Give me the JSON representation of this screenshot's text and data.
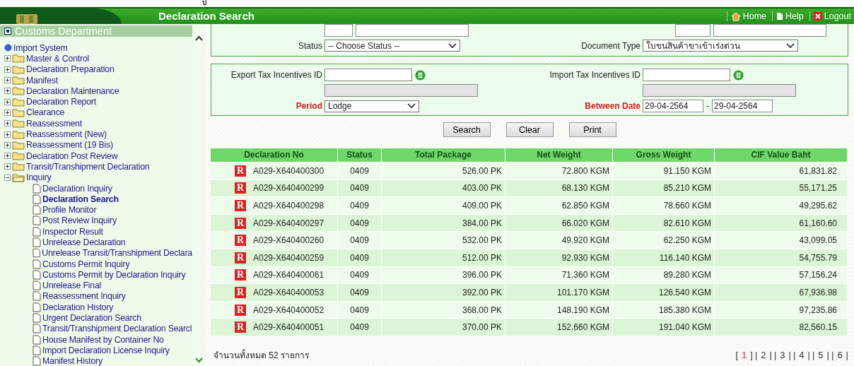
{
  "top_fragment": "ป",
  "header": {
    "title": "Declaration Search",
    "links": [
      {
        "label": "Home",
        "kind": "home"
      },
      {
        "label": "Help",
        "kind": "help"
      },
      {
        "label": "Logout",
        "kind": "logout"
      }
    ]
  },
  "sidebar": {
    "title": "Customs Department",
    "tree": {
      "label": "Import System",
      "children": [
        {
          "label": "Master & Control",
          "kind": "folder",
          "expanded": false
        },
        {
          "label": "Declaration Preparation",
          "kind": "folder",
          "expanded": false
        },
        {
          "label": "Manifest",
          "kind": "folder",
          "expanded": false
        },
        {
          "label": "Declaration Maintenance",
          "kind": "folder",
          "expanded": false
        },
        {
          "label": "Declaration Report",
          "kind": "folder",
          "expanded": false
        },
        {
          "label": "Clearance",
          "kind": "folder",
          "expanded": false
        },
        {
          "label": "Reassessment",
          "kind": "folder",
          "expanded": false
        },
        {
          "label": "Reassessment  (New)",
          "kind": "folder",
          "expanded": false
        },
        {
          "label": "Reassessment  (19 Bis)",
          "kind": "folder",
          "expanded": false
        },
        {
          "label": "Declaration Post Review",
          "kind": "folder",
          "expanded": false
        },
        {
          "label": "Transit/Transhipment Declaration",
          "kind": "folder",
          "expanded": false
        },
        {
          "label": "Inquiry",
          "kind": "folder",
          "expanded": true,
          "children": [
            {
              "label": "Declaration Inquiry",
              "kind": "page",
              "selected": false
            },
            {
              "label": "Declaration Search",
              "kind": "page",
              "selected": true
            },
            {
              "label": "Profile Monitor",
              "kind": "page",
              "selected": false
            },
            {
              "label": "Post Review Inquiry",
              "kind": "page",
              "selected": false
            },
            {
              "label": "Inspector Result",
              "kind": "page",
              "selected": false
            },
            {
              "label": "Unrelease Declaration",
              "kind": "page",
              "selected": false
            },
            {
              "label": "Unrelease Transit/Transhipment Declara",
              "kind": "page",
              "selected": false
            },
            {
              "label": "Customs Permit Inquiry",
              "kind": "page",
              "selected": false
            },
            {
              "label": "Customs Permit by Declaration Inquiry",
              "kind": "page",
              "selected": false
            },
            {
              "label": "Unrelease Final",
              "kind": "page",
              "selected": false
            },
            {
              "label": "Reassessment Inquiry",
              "kind": "page",
              "selected": false
            },
            {
              "label": "Declaration History",
              "kind": "page",
              "selected": false
            },
            {
              "label": "Urgent Declaration Search",
              "kind": "page",
              "selected": false
            },
            {
              "label": "Transit/Transhipment Declaration Searcl",
              "kind": "page",
              "selected": false
            },
            {
              "label": "House Manifest by Container No",
              "kind": "page",
              "selected": false
            },
            {
              "label": "Import Declaration License Inquiry",
              "kind": "page",
              "selected": false
            },
            {
              "label": "Manifest History",
              "kind": "page",
              "selected": false
            }
          ]
        }
      ]
    }
  },
  "form": {
    "status": {
      "label": "Status",
      "value": "-- Choose Status --"
    },
    "document_type": {
      "label": "Document Type",
      "value": "ใบขนสินค้าขาเข้าเร่งด่วน"
    },
    "export_tax": {
      "label": "Export Tax Incentives ID"
    },
    "import_tax": {
      "label": "Import Tax Incentives ID"
    },
    "period": {
      "label": "Period",
      "value": "Lodge"
    },
    "between_date": {
      "label": "Between Date",
      "from": "29-04-2564",
      "separator": "-",
      "to": "29-04-2564"
    },
    "buttons": [
      "Search",
      "Clear",
      "Print"
    ]
  },
  "table": {
    "columns": [
      "Declaration No",
      "Status",
      "Total Package",
      "Net Weight",
      "Gross Weight",
      "CIF Value Baht"
    ],
    "rows": [
      {
        "badge": "R",
        "declaration_no": "A029-X640400300",
        "status": "0409",
        "total_package": "526.00 PK",
        "net_weight": "72.800 KGM",
        "gross_weight": "91.150 KGM",
        "cif_value": "61,831.82"
      },
      {
        "badge": "R",
        "declaration_no": "A029-X640400299",
        "status": "0409",
        "total_package": "403.00 PK",
        "net_weight": "68.130 KGM",
        "gross_weight": "85.210 KGM",
        "cif_value": "55,171.25"
      },
      {
        "badge": "R",
        "declaration_no": "A029-X640400298",
        "status": "0409",
        "total_package": "409.00 PK",
        "net_weight": "62.850 KGM",
        "gross_weight": "78.660 KGM",
        "cif_value": "49,295.62"
      },
      {
        "badge": "R",
        "declaration_no": "A029-X640400297",
        "status": "0409",
        "total_package": "384.00 PK",
        "net_weight": "66.020 KGM",
        "gross_weight": "82.610 KGM",
        "cif_value": "61,160.60"
      },
      {
        "badge": "R",
        "declaration_no": "A029-X640400260",
        "status": "0409",
        "total_package": "532.00 PK",
        "net_weight": "49.920 KGM",
        "gross_weight": "62.250 KGM",
        "cif_value": "43,099.05"
      },
      {
        "badge": "R",
        "declaration_no": "A029-X640400259",
        "status": "0409",
        "total_package": "512.00 PK",
        "net_weight": "92.930 KGM",
        "gross_weight": "116.140 KGM",
        "cif_value": "54,755.79"
      },
      {
        "badge": "R",
        "declaration_no": "A029-X640400061",
        "status": "0409",
        "total_package": "396.00 PK",
        "net_weight": "71.360 KGM",
        "gross_weight": "89.280 KGM",
        "cif_value": "57,156.24"
      },
      {
        "badge": "R",
        "declaration_no": "A029-X640400053",
        "status": "0409",
        "total_package": "392.00 PK",
        "net_weight": "101.170 KGM",
        "gross_weight": "126.540 KGM",
        "cif_value": "67,936.98"
      },
      {
        "badge": "R",
        "declaration_no": "A029-X640400052",
        "status": "0409",
        "total_package": "368.00 PK",
        "net_weight": "148.190 KGM",
        "gross_weight": "185.380 KGM",
        "cif_value": "97,235.86"
      },
      {
        "badge": "R",
        "declaration_no": "A029-X640400051",
        "status": "0409",
        "total_package": "370.00 PK",
        "net_weight": "152.660 KGM",
        "gross_weight": "191.040 KGM",
        "cif_value": "82,560.15"
      }
    ]
  },
  "footer": {
    "total": "จำนวนทั้งหมด 52 รายการ",
    "pagination": {
      "selected_wrap": [
        "[",
        "]"
      ],
      "wrap": [
        "|",
        "|"
      ],
      "pages": [
        {
          "label": "1",
          "selected": true
        },
        {
          "label": "2",
          "selected": false
        },
        {
          "label": "3",
          "selected": false
        },
        {
          "label": "4",
          "selected": false
        },
        {
          "label": "5",
          "selected": false
        },
        {
          "label": "6",
          "selected": false
        }
      ]
    }
  }
}
